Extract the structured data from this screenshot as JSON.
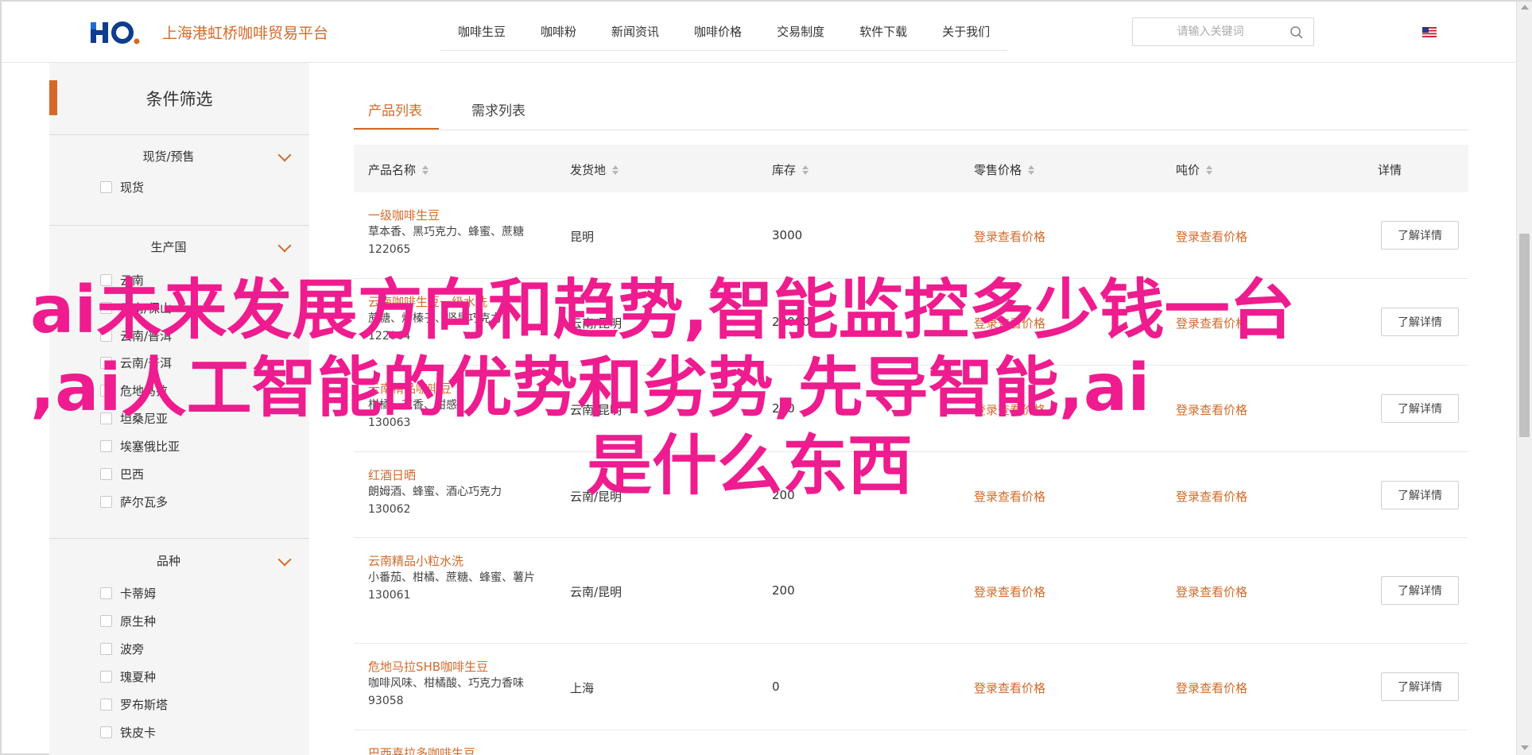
{
  "header": {
    "brand": "上海港虹桥咖啡贸易平台",
    "logo_text": "HQ",
    "nav": [
      "咖啡生豆",
      "咖啡粉",
      "新闻资讯",
      "咖啡价格",
      "交易制度",
      "软件下载",
      "关于我们"
    ],
    "search_placeholder": "请输入关键词",
    "flag": "us-flag-icon"
  },
  "sidebar": {
    "title": "条件筛选",
    "groups": [
      {
        "title": "现货/预售",
        "options": [
          "现货"
        ]
      },
      {
        "title": "生产国",
        "options": [
          "云南",
          "云南/保山",
          "云南/普洱",
          "云南/普洱",
          "危地马拉",
          "坦桑尼亚",
          "埃塞俄比亚",
          "巴西",
          "萨尔瓦多"
        ]
      },
      {
        "title": "品种",
        "options": [
          "卡蒂姆",
          "原生种",
          "波旁",
          "瑰夏种",
          "罗布斯塔",
          "铁皮卡"
        ]
      }
    ]
  },
  "tabs": [
    "产品列表",
    "需求列表"
  ],
  "table": {
    "columns": [
      "产品名称",
      "发货地",
      "库存",
      "零售价格",
      "吨价",
      "详情"
    ],
    "login_text": "登录查看价格",
    "detail_label": "了解详情",
    "rows": [
      {
        "name": "一级咖啡生豆",
        "desc": "草本香、黑巧克力、蜂蜜、蔗糖",
        "code": "122065",
        "origin": "昆明",
        "stock": "3000"
      },
      {
        "name": "云南咖啡生豆一级水洗",
        "desc": "蔗糖、烤榛子、坚果巧克力",
        "code": "122064",
        "origin": "云南/昆明",
        "stock": "20000"
      },
      {
        "name": "云南精品咖啡豆",
        "desc": "柑橘、花香、甜感",
        "code": "130063",
        "origin": "云南/昆明",
        "stock": "200"
      },
      {
        "name": "红酒日晒",
        "desc": "朗姆酒、蜂蜜、酒心巧克力",
        "code": "130062",
        "origin": "云南/昆明",
        "stock": "200"
      },
      {
        "name": "云南精品小粒水洗",
        "desc": "小番茄、柑橘、蔗糖、蜂蜜、薯片",
        "code": "130061",
        "origin": "云南/昆明",
        "stock": "200"
      },
      {
        "name": "危地马拉SHB咖啡生豆",
        "desc": "咖啡风味、柑橘酸、巧克力香味",
        "code": "93058",
        "origin": "上海",
        "stock": "0"
      },
      {
        "name": "巴西喜拉多咖啡生豆",
        "desc": "",
        "code": "",
        "origin": "",
        "stock": ""
      }
    ]
  },
  "overlay": {
    "line1": "ai未来发展方向和趋势,智能监控多少钱一台",
    "line2": ",ai人工智能的优势和劣势,先导智能,ai",
    "line3": "是什么东西"
  },
  "colors": {
    "accent": "#d36a2a",
    "overlay": "#ee1c8e",
    "sidebar_bg": "#f5f5f5"
  }
}
